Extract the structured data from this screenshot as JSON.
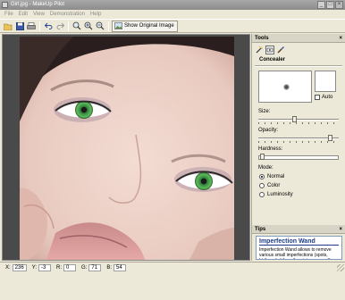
{
  "window": {
    "title": "Girl.jpg - MakeUp Pilot",
    "minimize_symbol": "_",
    "maximize_symbol": "□",
    "close_symbol": "×"
  },
  "menu": [
    "File",
    "Edit",
    "View",
    "Demonstration",
    "Help"
  ],
  "toolbar": {
    "show_original_label": "Show Original Image",
    "icons": [
      "open-icon",
      "save-icon",
      "print-icon",
      "undo-icon",
      "redo-icon",
      "zoom-fit-icon",
      "zoom-in-icon",
      "zoom-out-icon"
    ]
  },
  "tools_panel": {
    "header": "Tools",
    "close_symbol": "×",
    "tool_icons": [
      "wand-icon",
      "concealer-icon",
      "brush-icon"
    ],
    "active_tool": "Concealer",
    "auto_label": "Auto",
    "size_label": "Size:",
    "size_value": 0.45,
    "opacity_label": "Opacity:",
    "opacity_value": 0.92,
    "hardness_label": "Hardness:",
    "hardness_value": 0.02,
    "mode_label": "Mode:",
    "modes": [
      "Normal",
      "Color",
      "Luminosity"
    ],
    "selected_mode": "Normal"
  },
  "tips": {
    "header": "Tips",
    "close_symbol": "×",
    "title": "Imperfection Wand",
    "text": "Imperfection Wand allows to remove various small imperfections (spots, birthmarks) from the picture, as well as smoothen the skin."
  },
  "status": {
    "x_label": "X:",
    "x_value": "236",
    "y_label": "Y:",
    "y_value": "-3",
    "r_label": "R:",
    "r_value": "0",
    "g_label": "G:",
    "g_value": "71",
    "b_label": "B:",
    "b_value": "54"
  }
}
